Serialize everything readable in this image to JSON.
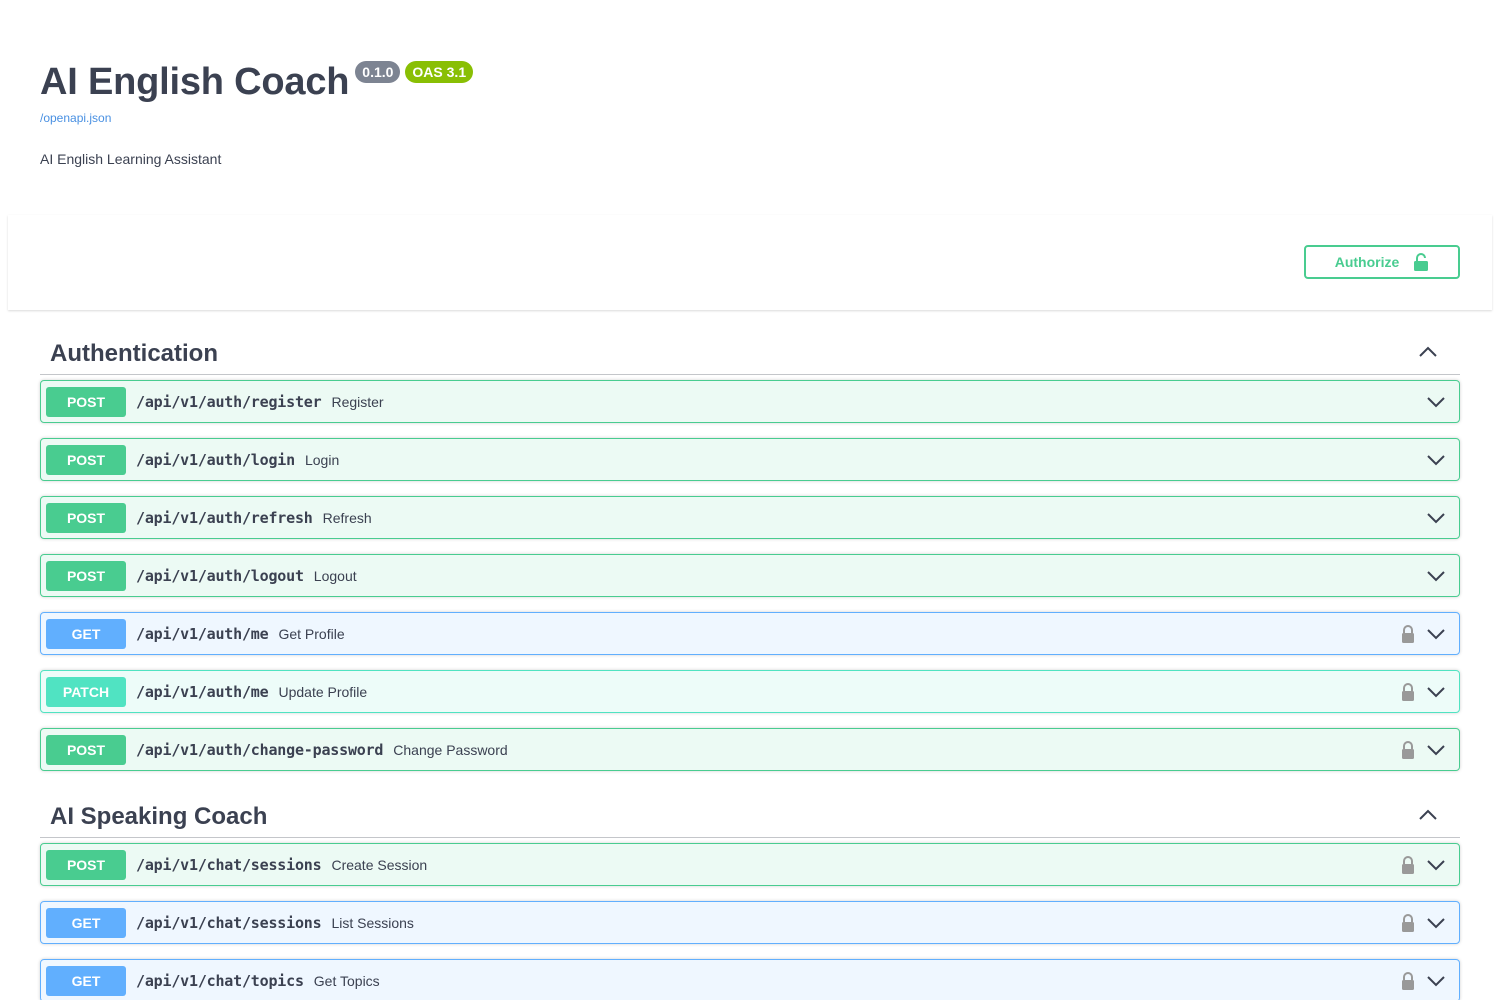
{
  "info": {
    "title": "AI English Coach",
    "version": "0.1.0",
    "oas": "OAS 3.1",
    "spec_link": "/openapi.json",
    "description": "AI English Learning Assistant"
  },
  "authorize": {
    "label": "Authorize"
  },
  "colors": {
    "post": "#49cc90",
    "get": "#61affe",
    "patch": "#50e3c2",
    "text": "#3b4151",
    "link": "#4990e2"
  },
  "tags": [
    {
      "name": "Authentication",
      "operations": [
        {
          "method": "POST",
          "path": "/api/v1/auth/register",
          "summary": "Register",
          "locked": false
        },
        {
          "method": "POST",
          "path": "/api/v1/auth/login",
          "summary": "Login",
          "locked": false
        },
        {
          "method": "POST",
          "path": "/api/v1/auth/refresh",
          "summary": "Refresh",
          "locked": false
        },
        {
          "method": "POST",
          "path": "/api/v1/auth/logout",
          "summary": "Logout",
          "locked": false
        },
        {
          "method": "GET",
          "path": "/api/v1/auth/me",
          "summary": "Get Profile",
          "locked": true
        },
        {
          "method": "PATCH",
          "path": "/api/v1/auth/me",
          "summary": "Update Profile",
          "locked": true
        },
        {
          "method": "POST",
          "path": "/api/v1/auth/change-password",
          "summary": "Change Password",
          "locked": true
        }
      ]
    },
    {
      "name": "AI Speaking Coach",
      "operations": [
        {
          "method": "POST",
          "path": "/api/v1/chat/sessions",
          "summary": "Create Session",
          "locked": true
        },
        {
          "method": "GET",
          "path": "/api/v1/chat/sessions",
          "summary": "List Sessions",
          "locked": true
        },
        {
          "method": "GET",
          "path": "/api/v1/chat/topics",
          "summary": "Get Topics",
          "locked": true
        }
      ]
    }
  ]
}
